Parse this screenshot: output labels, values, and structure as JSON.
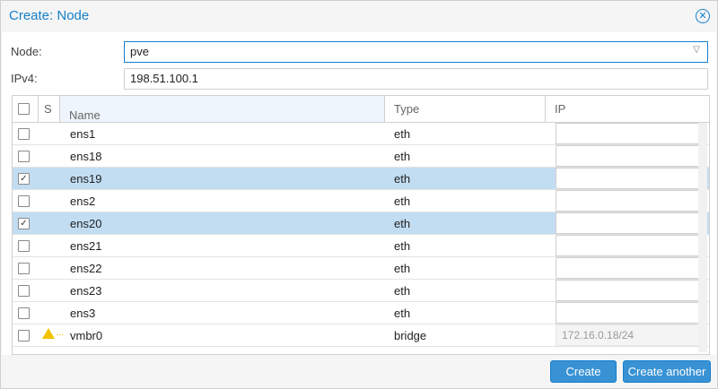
{
  "dialog": {
    "title": "Create: Node"
  },
  "form": {
    "node_label": "Node:",
    "node_value": "pve",
    "ipv4_label": "IPv4:",
    "ipv4_value": "198.51.100.1"
  },
  "grid": {
    "headers": {
      "select": "",
      "s": "S",
      "name": "Name",
      "type": "Type",
      "ip": "IP"
    },
    "rows": [
      {
        "name": "ens1",
        "type": "eth",
        "checked": false,
        "selected": false,
        "ip": ""
      },
      {
        "name": "ens18",
        "type": "eth",
        "checked": false,
        "selected": false,
        "ip": ""
      },
      {
        "name": "ens19",
        "type": "eth",
        "checked": true,
        "selected": true,
        "ip": ""
      },
      {
        "name": "ens2",
        "type": "eth",
        "checked": false,
        "selected": false,
        "ip": ""
      },
      {
        "name": "ens20",
        "type": "eth",
        "checked": true,
        "selected": true,
        "ip": ""
      },
      {
        "name": "ens21",
        "type": "eth",
        "checked": false,
        "selected": false,
        "ip": ""
      },
      {
        "name": "ens22",
        "type": "eth",
        "checked": false,
        "selected": false,
        "ip": ""
      },
      {
        "name": "ens23",
        "type": "eth",
        "checked": false,
        "selected": false,
        "ip": ""
      },
      {
        "name": "ens3",
        "type": "eth",
        "checked": false,
        "selected": false,
        "ip": ""
      },
      {
        "name": "vmbr0",
        "type": "bridge",
        "checked": false,
        "selected": false,
        "ip": "172.16.0.18/24",
        "warning": true
      }
    ]
  },
  "footer": {
    "create": "Create",
    "create_another": "Create another"
  },
  "colors": {
    "accent": "#157fcc",
    "selected_row": "#c2ddf2",
    "warning": "#f2c200"
  }
}
